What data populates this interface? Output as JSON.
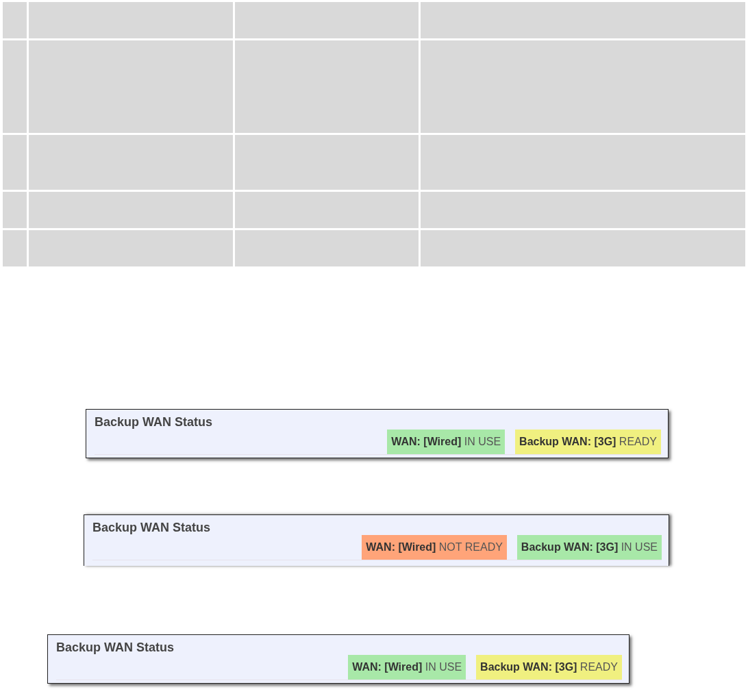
{
  "table": {
    "columns": [
      {
        "kind": "narrow"
      },
      {
        "kind": "wide"
      },
      {
        "kind": "medium"
      },
      {
        "kind": "widest"
      }
    ],
    "rows": [
      {
        "kind": "header"
      },
      {
        "kind": "tall"
      },
      {
        "kind": "medium"
      },
      {
        "kind": "short"
      },
      {
        "kind": "short"
      }
    ]
  },
  "panels": [
    {
      "title": "Backup WAN Status",
      "cut_off": false,
      "badges": [
        {
          "text": "**WAN: [Wired]** IN USE",
          "color": "#a8e8a8"
        },
        {
          "text": "**Backup WAN: [3G]** READY",
          "color": "#f0f080"
        }
      ]
    },
    {
      "title": "Backup WAN Status",
      "cut_off": true,
      "badges": [
        {
          "text": "**WAN: [Wired]** NOT READY",
          "color": "#ffa479"
        },
        {
          "text": "**Backup WAN: [3G]** IN USE",
          "color": "#a8e8a8"
        }
      ]
    },
    {
      "title": "Backup WAN Status",
      "cut_off": false,
      "badges": [
        {
          "text": "**WAN: [Wired]** IN USE",
          "color": "#a8e8a8"
        },
        {
          "text": "**Backup WAN: [3G]** READY",
          "color": "#f0f080"
        }
      ]
    }
  ]
}
